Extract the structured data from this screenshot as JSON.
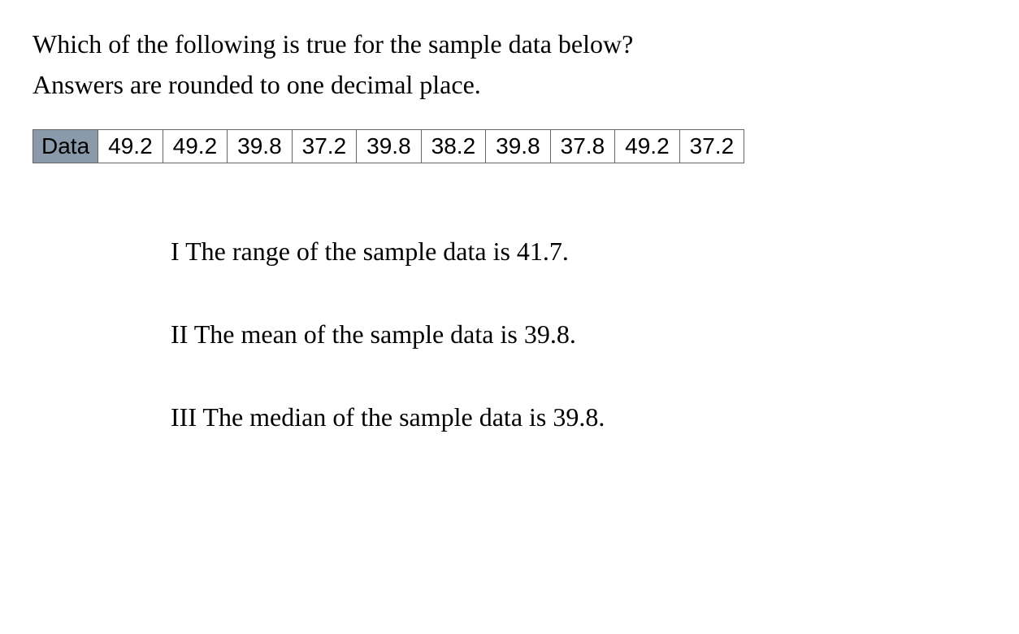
{
  "question": {
    "line1": "Which of the following is true for the sample data below?",
    "line2": "Answers are rounded to one decimal place."
  },
  "table": {
    "label": "Data",
    "values": [
      "49.2",
      "49.2",
      "39.8",
      "37.2",
      "39.8",
      "38.2",
      "39.8",
      "37.8",
      "49.2",
      "37.2"
    ]
  },
  "statements": {
    "s1": "I The range of the sample data is 41.7.",
    "s2": "II The mean of the sample data is 39.8.",
    "s3": "III The median of the sample data is 39.8."
  },
  "chart_data": {
    "type": "table",
    "title": "Sample Data",
    "categories": [
      "Data"
    ],
    "values": [
      49.2,
      49.2,
      39.8,
      37.2,
      39.8,
      38.2,
      39.8,
      37.8,
      49.2,
      37.2
    ]
  }
}
